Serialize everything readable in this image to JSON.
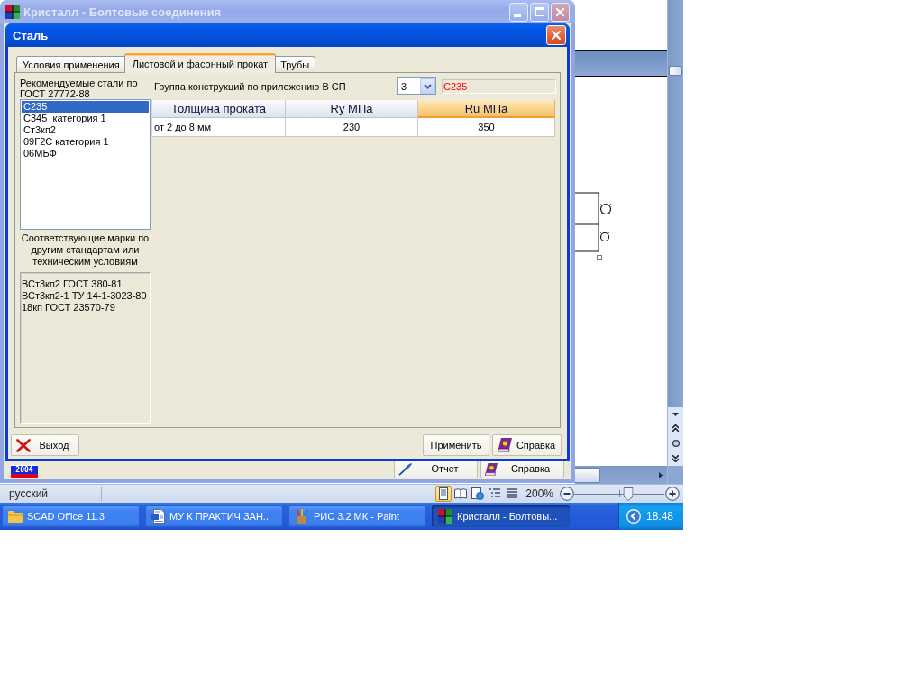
{
  "background_window": {
    "status_bar": {
      "language": "русский",
      "view_buttons": [
        {
          "kind": "print",
          "selected": true
        },
        {
          "kind": "reading",
          "selected": false
        },
        {
          "kind": "web",
          "selected": false
        },
        {
          "kind": "outline",
          "selected": false
        },
        {
          "kind": "draft",
          "selected": false
        }
      ],
      "zoom": "200%",
      "zoom_slider": {
        "level": 0.6
      }
    }
  },
  "app_window": {
    "title": "Кристалл - Болтовые соединения",
    "active": false,
    "logo": "2004",
    "buttons": [
      {
        "label": "Отчет",
        "kind": "report"
      },
      {
        "label": "Справка",
        "kind": "help"
      }
    ]
  },
  "dialog": {
    "title": "Сталь",
    "active": true,
    "tabs": [
      {
        "label": "Условия применения",
        "selected": false
      },
      {
        "label": "Листовой и фасонный прокат",
        "selected": true
      },
      {
        "label": "Трубы",
        "selected": false
      }
    ],
    "recommended_steels": {
      "label": "Рекомендуемые стали по ГОСТ 27772-88",
      "items": [
        {
          "label": "С235",
          "selected": true
        },
        {
          "label": "С345  категория 1",
          "selected": false
        },
        {
          "label": "Ст3кп2",
          "selected": false
        },
        {
          "label": "09Г2С категория 1",
          "selected": false
        },
        {
          "label": "06МБФ",
          "selected": false
        }
      ]
    },
    "equivalent_grades": {
      "label": "Соответствующие марки по другим стандартам или техническим условиям",
      "lines": [
        "ВСт3кп2 ГОСТ 380-81",
        "ВСт3кп2-1 ТУ 14-1-3023-80",
        "18кп ГОСТ 23570-79"
      ]
    },
    "construction_group": {
      "label": "Группа конструкций по приложению В СП",
      "value": "3",
      "steel": "С235"
    },
    "table": {
      "columns": [
        {
          "label": "Толщина проката",
          "selected": false
        },
        {
          "label": "Ry МПа",
          "selected": false
        },
        {
          "label": "Ru МПа",
          "selected": true
        }
      ],
      "rows": [
        [
          "от 2 до 8 мм",
          "230",
          "350"
        ]
      ]
    },
    "buttons": [
      {
        "label": "Выход",
        "kind": "exit"
      },
      {
        "label": "Применить",
        "kind": "plain"
      },
      {
        "label": "Справка",
        "kind": "help"
      }
    ]
  },
  "taskbar": {
    "items": [
      {
        "label": "SCAD Office 11.3",
        "kind": "folder",
        "selected": false
      },
      {
        "label": "МУ К ПРАКТИЧ ЗАН...",
        "kind": "document",
        "selected": false
      },
      {
        "label": "РИС 3.2 МК - Paint",
        "kind": "paint",
        "selected": false
      },
      {
        "label": "Кристалл - Болтовы...",
        "kind": "app",
        "selected": true
      }
    ],
    "clock": "18:48"
  }
}
